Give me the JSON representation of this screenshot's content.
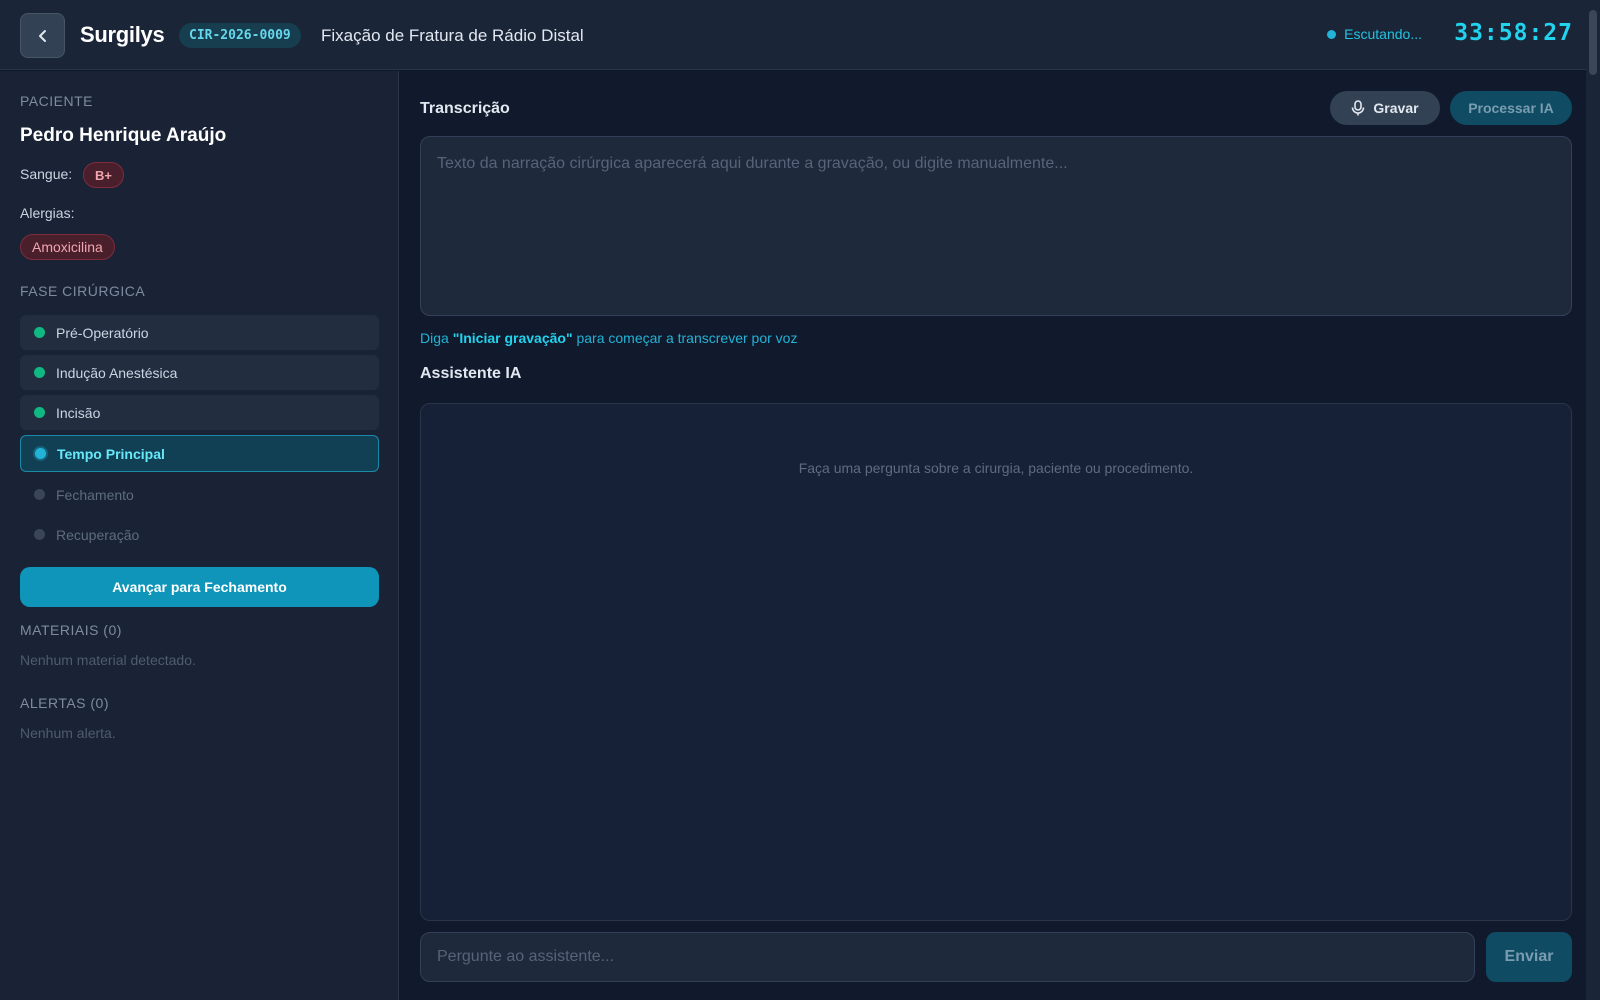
{
  "header": {
    "back_icon": "chevron-left-icon",
    "brand": "Surgilys",
    "case_id": "CIR-2026-0009",
    "procedure": "Fixação de Fratura de Rádio Distal",
    "listening_label": "Escutando...",
    "timer": "33:58:27"
  },
  "sidebar": {
    "patient_section": "PACIENTE",
    "patient_name": "Pedro Henrique Araújo",
    "blood_label": "Sangue:",
    "blood_type": "B+",
    "allergies_label": "Alergias:",
    "allergies": [
      "Amoxicilina"
    ],
    "phase_section": "FASE CIRÚRGICA",
    "phases": [
      {
        "label": "Pré-Operatório",
        "status": "done"
      },
      {
        "label": "Indução Anestésica",
        "status": "done"
      },
      {
        "label": "Incisão",
        "status": "done"
      },
      {
        "label": "Tempo Principal",
        "status": "active"
      },
      {
        "label": "Fechamento",
        "status": "pending"
      },
      {
        "label": "Recuperação",
        "status": "pending"
      }
    ],
    "advance_button": "Avançar para Fechamento",
    "materials_section": "MATERIAIS (0)",
    "materials_empty": "Nenhum material detectado.",
    "alerts_section": "ALERTAS (0)",
    "alerts_empty": "Nenhum alerta."
  },
  "main": {
    "transcription_title": "Transcrição",
    "record_button": "Gravar",
    "record_icon": "microphone-icon",
    "process_button": "Processar IA",
    "transcript_placeholder": "Texto da narração cirúrgica aparecerá aqui durante a gravação, ou digite manualmente...",
    "voice_hint_prefix": "Diga ",
    "voice_hint_command": "\"Iniciar gravação\"",
    "voice_hint_suffix": " para começar a transcrever por voz",
    "assistant_title": "Assistente IA",
    "assistant_empty": "Faça uma pergunta sobre a cirurgia, paciente ou procedimento.",
    "ask_placeholder": "Pergunte ao assistente...",
    "send_button": "Enviar"
  },
  "colors": {
    "accent": "#22d3ee",
    "primary_button": "#0e95b9",
    "done_phase": "#10b981",
    "allergy_badge": "#4a1f2c"
  }
}
